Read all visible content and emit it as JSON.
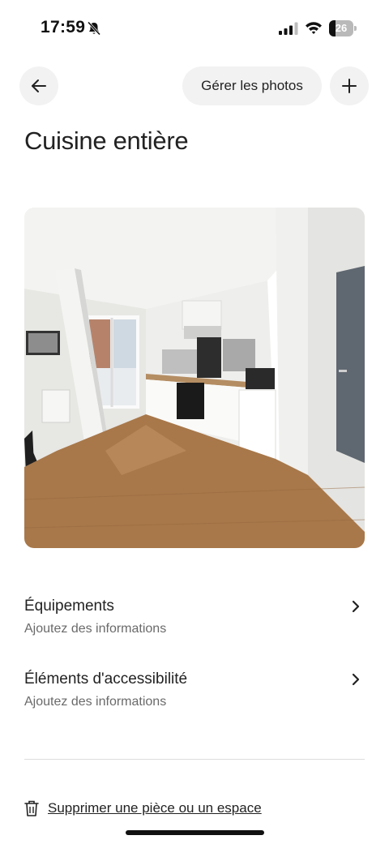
{
  "status_bar": {
    "time": "17:59",
    "battery_level": "26",
    "battery_fraction": 0.26,
    "icons": [
      "mute-bell-icon",
      "cellular-signal-icon",
      "wifi-icon",
      "battery-icon"
    ]
  },
  "header": {
    "back_icon": "arrow-left-icon",
    "manage_photos_label": "Gérer les photos",
    "add_icon": "plus-icon"
  },
  "page": {
    "title": "Cuisine entière"
  },
  "photo": {
    "alt": "Cuisine entière"
  },
  "sections": [
    {
      "title": "Équipements",
      "subtitle": "Ajoutez des informations",
      "icon": "chevron-right-icon"
    },
    {
      "title": "Éléments d'accessibilité",
      "subtitle": "Ajoutez des informations",
      "icon": "chevron-right-icon"
    }
  ],
  "footer": {
    "delete_icon": "trash-icon",
    "delete_label": "Supprimer une pièce ou un espace"
  },
  "colors": {
    "text": "#222222",
    "secondary_text": "#6a6a6a",
    "button_bg": "#f2f2f2",
    "divider": "#dddddd",
    "floor": "#a8784a",
    "wall": "#ededeb"
  }
}
